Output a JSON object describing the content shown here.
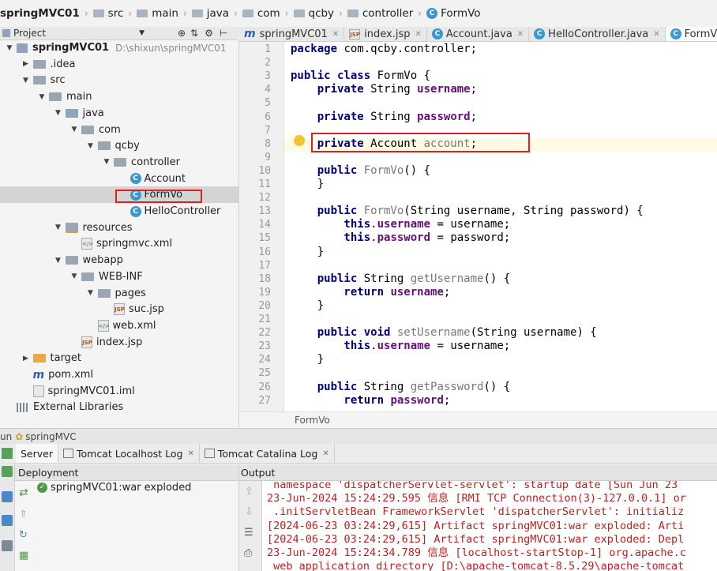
{
  "breadcrumb": [
    "springMVC01",
    "src",
    "main",
    "java",
    "com",
    "qcby",
    "controller",
    "FormVo"
  ],
  "project_panel": {
    "title": "Project"
  },
  "tree": [
    {
      "label": "springMVC01",
      "path": "D:\\shixun\\springMVC01",
      "icon": "module",
      "depth": 0,
      "arrow": "down",
      "bold": true
    },
    {
      "label": ".idea",
      "icon": "folder",
      "depth": 1,
      "arrow": "right"
    },
    {
      "label": "src",
      "icon": "folder",
      "depth": 1,
      "arrow": "down"
    },
    {
      "label": "main",
      "icon": "folder",
      "depth": 2,
      "arrow": "down"
    },
    {
      "label": "java",
      "icon": "src-folder",
      "depth": 3,
      "arrow": "down"
    },
    {
      "label": "com",
      "icon": "folder",
      "depth": 4,
      "arrow": "down"
    },
    {
      "label": "qcby",
      "icon": "folder",
      "depth": 5,
      "arrow": "down"
    },
    {
      "label": "controller",
      "icon": "folder",
      "depth": 6,
      "arrow": "down"
    },
    {
      "label": "Account",
      "icon": "class",
      "depth": 7,
      "arrow": ""
    },
    {
      "label": "FormVo",
      "icon": "class",
      "depth": 7,
      "arrow": "",
      "selected": true
    },
    {
      "label": "HelloController",
      "icon": "class",
      "depth": 7,
      "arrow": ""
    },
    {
      "label": "resources",
      "icon": "res-folder",
      "depth": 3,
      "arrow": "down"
    },
    {
      "label": "springmvc.xml",
      "icon": "xml",
      "depth": 4,
      "arrow": ""
    },
    {
      "label": "webapp",
      "icon": "folder",
      "depth": 3,
      "arrow": "down"
    },
    {
      "label": "WEB-INF",
      "icon": "folder",
      "depth": 4,
      "arrow": "down"
    },
    {
      "label": "pages",
      "icon": "folder",
      "depth": 5,
      "arrow": "down"
    },
    {
      "label": "suc.jsp",
      "icon": "jsp",
      "depth": 6,
      "arrow": ""
    },
    {
      "label": "web.xml",
      "icon": "xml",
      "depth": 5,
      "arrow": ""
    },
    {
      "label": "index.jsp",
      "icon": "jsp",
      "depth": 4,
      "arrow": ""
    },
    {
      "label": "target",
      "icon": "orange-folder",
      "depth": 1,
      "arrow": "right"
    },
    {
      "label": "pom.xml",
      "icon": "maven",
      "depth": 1,
      "arrow": ""
    },
    {
      "label": "springMVC01.iml",
      "icon": "iml",
      "depth": 1,
      "arrow": ""
    },
    {
      "label": "External Libraries",
      "icon": "lib",
      "depth": 0,
      "arrow": ""
    }
  ],
  "tabs": [
    {
      "label": "springMVC01",
      "icon": "m"
    },
    {
      "label": "index.jsp",
      "icon": "jsp"
    },
    {
      "label": "Account.java",
      "icon": "class"
    },
    {
      "label": "HelloController.java",
      "icon": "class"
    },
    {
      "label": "FormVo.java",
      "icon": "class",
      "active": true
    }
  ],
  "code_lines": [
    [
      {
        "t": "package ",
        "c": "kw"
      },
      {
        "t": "com.qcby.controller;",
        "c": ""
      }
    ],
    [],
    [
      {
        "t": "public class ",
        "c": "kw"
      },
      {
        "t": "FormVo {",
        "c": ""
      }
    ],
    [
      {
        "t": "    private ",
        "c": "kw"
      },
      {
        "t": "String ",
        "c": ""
      },
      {
        "t": "username",
        "c": "fld"
      },
      {
        "t": ";",
        "c": ""
      }
    ],
    [],
    [
      {
        "t": "    private ",
        "c": "kw"
      },
      {
        "t": "String ",
        "c": ""
      },
      {
        "t": "password",
        "c": "fld"
      },
      {
        "t": ";",
        "c": ""
      }
    ],
    [],
    [
      {
        "t": "    private ",
        "c": "kw"
      },
      {
        "t": "Account ",
        "c": ""
      },
      {
        "t": "account",
        "c": "mth"
      },
      {
        "t": ";",
        "c": ""
      }
    ],
    [],
    [
      {
        "t": "    public ",
        "c": "kw"
      },
      {
        "t": "FormVo",
        "c": "mth"
      },
      {
        "t": "() {",
        "c": ""
      }
    ],
    [
      {
        "t": "    }",
        "c": ""
      }
    ],
    [],
    [
      {
        "t": "    public ",
        "c": "kw"
      },
      {
        "t": "FormVo",
        "c": "mth"
      },
      {
        "t": "(String username, String password) {",
        "c": ""
      }
    ],
    [
      {
        "t": "        this",
        "c": "kw"
      },
      {
        "t": ".",
        "c": ""
      },
      {
        "t": "username",
        "c": "fld"
      },
      {
        "t": " = username;",
        "c": ""
      }
    ],
    [
      {
        "t": "        this",
        "c": "kw"
      },
      {
        "t": ".",
        "c": ""
      },
      {
        "t": "password",
        "c": "fld"
      },
      {
        "t": " = password;",
        "c": ""
      }
    ],
    [
      {
        "t": "    }",
        "c": ""
      }
    ],
    [],
    [
      {
        "t": "    public ",
        "c": "kw"
      },
      {
        "t": "String ",
        "c": ""
      },
      {
        "t": "getUsername",
        "c": "mth"
      },
      {
        "t": "() {",
        "c": ""
      }
    ],
    [
      {
        "t": "        return ",
        "c": "kw"
      },
      {
        "t": "username",
        "c": "fld"
      },
      {
        "t": ";",
        "c": ""
      }
    ],
    [
      {
        "t": "    }",
        "c": ""
      }
    ],
    [],
    [
      {
        "t": "    public void ",
        "c": "kw"
      },
      {
        "t": "setUsername",
        "c": "mth"
      },
      {
        "t": "(String username) {",
        "c": ""
      }
    ],
    [
      {
        "t": "        this",
        "c": "kw"
      },
      {
        "t": ".",
        "c": ""
      },
      {
        "t": "username",
        "c": "fld"
      },
      {
        "t": " = username;",
        "c": ""
      }
    ],
    [
      {
        "t": "    }",
        "c": ""
      }
    ],
    [],
    [
      {
        "t": "    public ",
        "c": "kw"
      },
      {
        "t": "String ",
        "c": ""
      },
      {
        "t": "getPassword",
        "c": "mth"
      },
      {
        "t": "() {",
        "c": ""
      }
    ],
    [
      {
        "t": "        return ",
        "c": "kw"
      },
      {
        "t": "password",
        "c": "fld"
      },
      {
        "t": ";",
        "c": ""
      }
    ]
  ],
  "editor_status": "FormVo",
  "run": {
    "title": "springMVC",
    "tabs": [
      "Server",
      "Tomcat Localhost Log",
      "Tomcat Catalina Log"
    ],
    "deployment_header": "Deployment",
    "output_header": "Output",
    "deployment_items": [
      "springMVC01:war exploded"
    ],
    "output_lines": [
      " namespace 'dispatcherServlet-servlet': startup date [Sun Jun 23",
      "23-Jun-2024 15:24:29.595 信息 [RMI TCP Connection(3)-127.0.0.1] or",
      " .initServletBean FrameworkServlet 'dispatcherServlet': initializ",
      "[2024-06-23 03:24:29,615] Artifact springMVC01:war exploded: Arti",
      "[2024-06-23 03:24:29,615] Artifact springMVC01:war exploded: Depl",
      "23-Jun-2024 15:24:34.789 信息 [localhost-startStop-1] org.apache.c",
      " web application directory [D:\\apache-tomcat-8.5.29\\apache-tomcat"
    ]
  },
  "colors": {
    "highlight": "#e02020",
    "keyword": "#000080",
    "field": "#660e7a",
    "output": "#c02020"
  }
}
